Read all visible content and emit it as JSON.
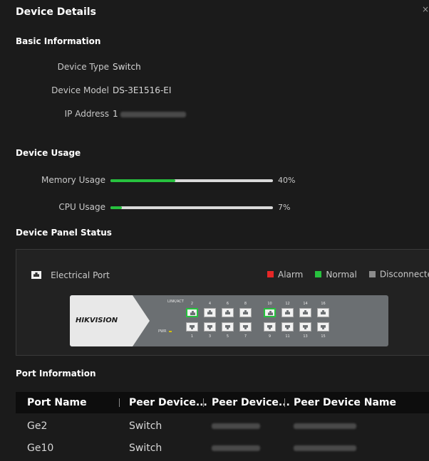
{
  "dialog": {
    "title": "Device Details",
    "close": "×"
  },
  "basic": {
    "heading": "Basic Information",
    "fields": [
      {
        "label": "Device Type",
        "value": "Switch"
      },
      {
        "label": "Device Model",
        "value": "DS-3E1516-EI"
      },
      {
        "label": "IP Address",
        "value": "1"
      }
    ]
  },
  "usage": {
    "heading": "Device Usage",
    "memory": {
      "label": "Memory Usage",
      "percent_text": "40%",
      "fraction": 0.4
    },
    "cpu": {
      "label": "CPU Usage",
      "percent_text": "7%",
      "fraction": 0.07
    }
  },
  "panel": {
    "heading": "Device Panel Status",
    "port_type": "Electrical Port",
    "legend": [
      {
        "label": "Alarm",
        "color": "#e62727"
      },
      {
        "label": "Normal",
        "color": "#27c13e"
      },
      {
        "label": "Disconnected",
        "color": "#8c8c8c"
      }
    ],
    "brand": "HIKVISION",
    "linkact": "LINK/ACT",
    "pwr": "PWR",
    "top_ports": [
      "2",
      "4",
      "6",
      "8",
      "10",
      "12",
      "14",
      "16"
    ],
    "bottom_ports": [
      "1",
      "3",
      "5",
      "7",
      "9",
      "11",
      "13",
      "15"
    ],
    "normal_ports": [
      "2",
      "10"
    ]
  },
  "ports": {
    "heading": "Port Information",
    "columns": [
      "Port Name",
      "Peer Device...",
      "Peer Device...",
      "Peer Device Name"
    ],
    "rows": [
      {
        "port": "Ge2",
        "peer_type": "Switch"
      },
      {
        "port": "Ge10",
        "peer_type": "Switch"
      }
    ]
  },
  "colors": {
    "accent_green": "#27c13e",
    "alarm_red": "#e62727",
    "disconnected_gray": "#8c8c8c"
  }
}
